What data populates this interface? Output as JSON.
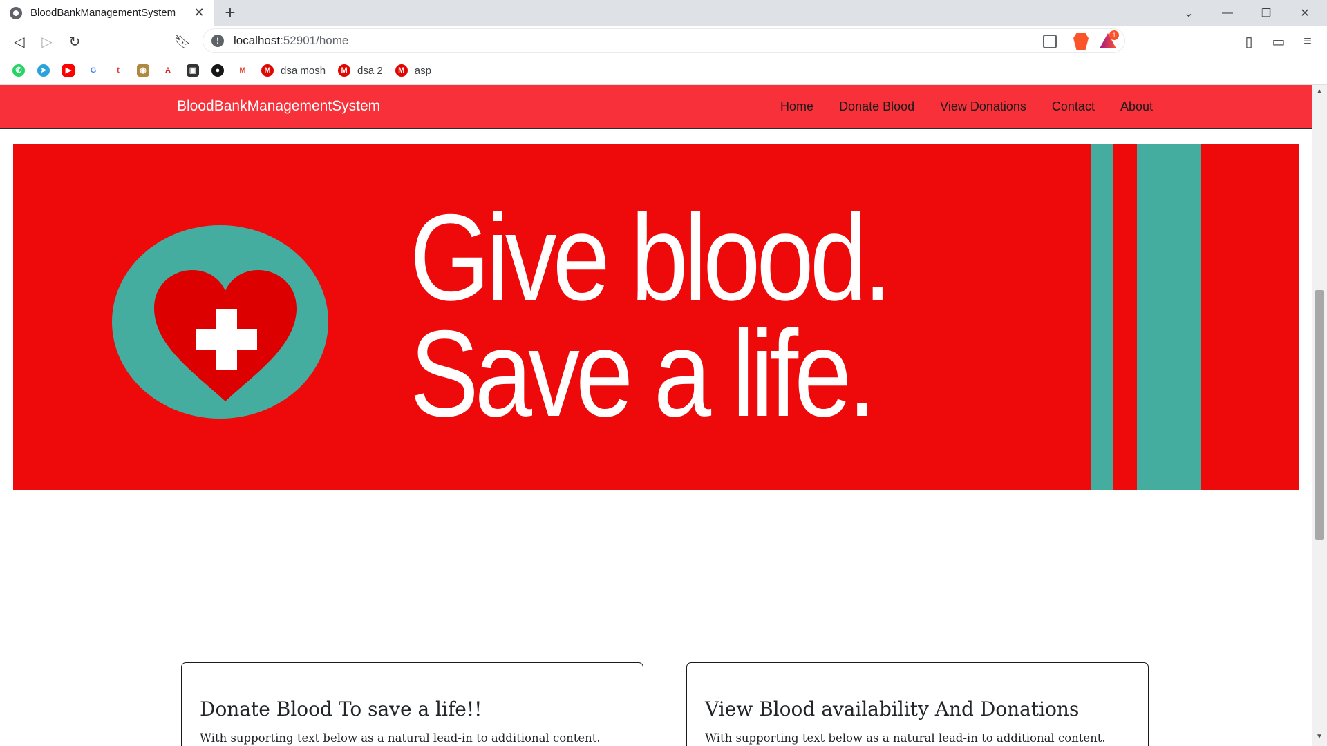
{
  "browser": {
    "tab_title": "BloodBankManagementSystem",
    "url_host": "localhost",
    "url_path": ":52901/home",
    "rewards_count": "1",
    "bookmarks": [
      {
        "label": "",
        "icon": "whatsapp-icon",
        "color": "#25d366"
      },
      {
        "label": "",
        "icon": "telegram-icon",
        "color": "#2aa3dc"
      },
      {
        "label": "",
        "icon": "youtube-icon",
        "color": "#ff0000"
      },
      {
        "label": "",
        "icon": "google-icon",
        "color": "#4285f4"
      },
      {
        "label": "",
        "icon": "tcs-icon",
        "color": "#e53935"
      },
      {
        "label": "",
        "icon": "portal-icon",
        "color": "#b08940"
      },
      {
        "label": "",
        "icon": "aon-icon",
        "color": "#e11b22"
      },
      {
        "label": "",
        "icon": "contacts-icon",
        "color": "#333333"
      },
      {
        "label": "",
        "icon": "github-icon",
        "color": "#181717"
      },
      {
        "label": "",
        "icon": "gmail-icon",
        "color": "#ea4335"
      },
      {
        "label": "dsa mosh",
        "icon": "mosh-icon",
        "color": "#e10600"
      },
      {
        "label": "dsa 2",
        "icon": "mosh-icon",
        "color": "#e10600"
      },
      {
        "label": "asp",
        "icon": "mosh-icon",
        "color": "#e10600"
      }
    ]
  },
  "site": {
    "brand": "BloodBankManagementSystem",
    "nav": [
      "Home",
      "Donate Blood",
      "View Donations",
      "Contact",
      "About"
    ],
    "hero": {
      "line1": "Give blood.",
      "line2": "Save a life."
    },
    "cards": [
      {
        "title": "Donate Blood To save a life!!",
        "text": "With supporting text below as a natural lead-in to additional content."
      },
      {
        "title": "View Blood availability And Donations",
        "text": "With supporting text below as a natural lead-in to additional content."
      }
    ]
  },
  "colors": {
    "navbar": "#f8303a",
    "hero_red": "#ee0a0a",
    "hero_teal": "#44ad9f",
    "heart": "#dc0000"
  }
}
